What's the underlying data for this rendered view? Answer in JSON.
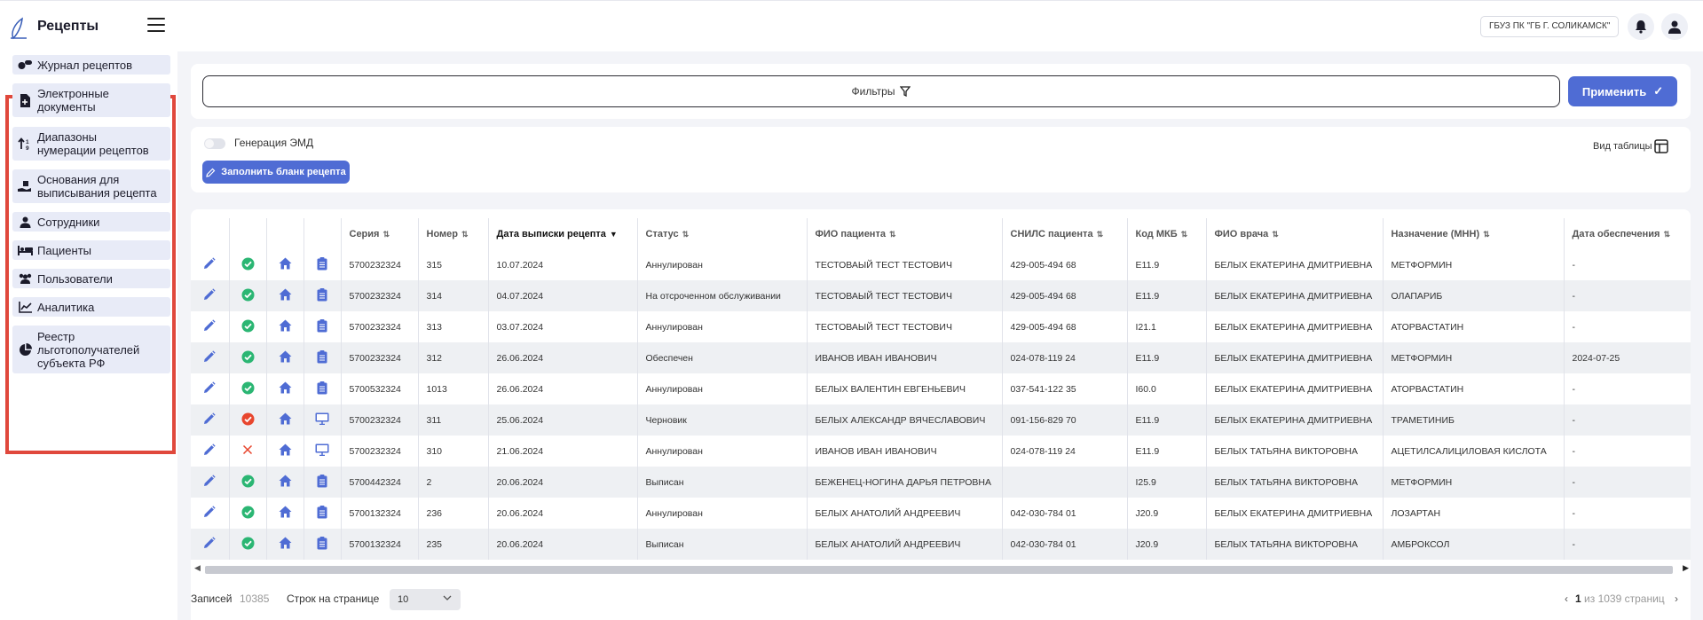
{
  "app": {
    "title": "Рецепты"
  },
  "header": {
    "org": "ГБУЗ ПК \"ГБ Г. СОЛИКАМСК\""
  },
  "sidebar": {
    "items": [
      {
        "label": "Журнал рецептов",
        "icon": "pills-icon"
      },
      {
        "label": "Электронные\nдокументы",
        "icon": "file-icon"
      },
      {
        "label": "Диапазоны\nнумерации рецептов",
        "icon": "sort-numeric-icon"
      },
      {
        "label": "Основания для\nвыписывания рецепта",
        "icon": "hand-receive-icon"
      },
      {
        "label": "Сотрудники",
        "icon": "user-icon"
      },
      {
        "label": "Пациенты",
        "icon": "bed-icon"
      },
      {
        "label": "Пользователи",
        "icon": "users-icon"
      },
      {
        "label": "Аналитика",
        "icon": "line-chart-icon"
      },
      {
        "label": "Реестр\nльготополучателей\nсубъекта РФ",
        "icon": "pie-chart-icon"
      }
    ]
  },
  "filters": {
    "label": "Фильтры",
    "apply_label": "Применить"
  },
  "toolbar": {
    "emd_toggle_label": "Генерация ЭМД",
    "fill_button_label": "Заполнить бланк рецепта",
    "view_label": "Вид таблицы"
  },
  "table": {
    "columns": [
      "Серия",
      "Номер",
      "Дата выписки рецепта",
      "Статус",
      "ФИО пациента",
      "СНИЛС пациента",
      "Код МКБ",
      "ФИО врача",
      "Назначение (МНН)",
      "Дата обеспечения"
    ],
    "rows": [
      {
        "status_icon": "check-circle-icon",
        "doc_icon": "clipboard-icon",
        "cells": [
          "5700232324",
          "315",
          "10.07.2024",
          "Аннулирован",
          "ТЕСТОВАЫЙ ТЕСТ ТЕСТОВИЧ",
          "429-005-494 68",
          "E11.9",
          "БЕЛЫХ ЕКАТЕРИНА ДМИТРИЕВНА",
          "МЕТФОРМИН",
          "-"
        ]
      },
      {
        "status_icon": "check-circle-icon",
        "doc_icon": "clipboard-icon",
        "cells": [
          "5700232324",
          "314",
          "04.07.2024",
          "На отсроченном обслуживании",
          "ТЕСТОВАЫЙ ТЕСТ ТЕСТОВИЧ",
          "429-005-494 68",
          "E11.9",
          "БЕЛЫХ ЕКАТЕРИНА ДМИТРИЕВНА",
          "ОЛАПАРИБ",
          "-"
        ]
      },
      {
        "status_icon": "check-circle-icon",
        "doc_icon": "clipboard-icon",
        "cells": [
          "5700232324",
          "313",
          "03.07.2024",
          "Аннулирован",
          "ТЕСТОВАЫЙ ТЕСТ ТЕСТОВИЧ",
          "429-005-494 68",
          "I21.1",
          "БЕЛЫХ ЕКАТЕРИНА ДМИТРИЕВНА",
          "АТОРВАСТАТИН",
          "-"
        ]
      },
      {
        "status_icon": "check-circle-icon",
        "doc_icon": "clipboard-icon",
        "cells": [
          "5700232324",
          "312",
          "26.06.2024",
          "Обеспечен",
          "ИВАНОВ ИВАН ИВАНОВИЧ",
          "024-078-119 24",
          "E11.9",
          "БЕЛЫХ ЕКАТЕРИНА ДМИТРИЕВНА",
          "МЕТФОРМИН",
          "2024-07-25"
        ]
      },
      {
        "status_icon": "check-circle-icon",
        "doc_icon": "clipboard-icon",
        "cells": [
          "5700532324",
          "1013",
          "26.06.2024",
          "Аннулирован",
          "БЕЛЫХ ВАЛЕНТИН ЕВГЕНЬЕВИЧ",
          "037-541-122 35",
          "I60.0",
          "БЕЛЫХ ЕКАТЕРИНА ДМИТРИЕВНА",
          "АТОРВАСТАТИН",
          "-"
        ]
      },
      {
        "status_icon": "error-circle-icon",
        "doc_icon": "monitor-icon",
        "cells": [
          "5700232324",
          "311",
          "25.06.2024",
          "Черновик",
          "БЕЛЫХ АЛЕКСАНДР ВЯЧЕСЛАВОВИЧ",
          "091-156-829 70",
          "E11.9",
          "БЕЛЫХ ЕКАТЕРИНА ДМИТРИЕВНА",
          "ТРАМЕТИНИБ",
          "-"
        ]
      },
      {
        "status_icon": "cross-icon",
        "doc_icon": "monitor-icon",
        "cells": [
          "5700232324",
          "310",
          "21.06.2024",
          "Аннулирован",
          "ИВАНОВ ИВАН ИВАНОВИЧ",
          "024-078-119 24",
          "E11.9",
          "БЕЛЫХ ТАТЬЯНА ВИКТОРОВНА",
          "АЦЕТИЛСАЛИЦИЛОВАЯ КИСЛОТА",
          "-"
        ]
      },
      {
        "status_icon": "check-circle-icon",
        "doc_icon": "clipboard-icon",
        "cells": [
          "5700442324",
          "2",
          "20.06.2024",
          "Выписан",
          "БЕЖЕНЕЦ-НОГИНА ДАРЬЯ ПЕТРОВНА",
          "",
          "I25.9",
          "БЕЛЫХ ТАТЬЯНА ВИКТОРОВНА",
          "МЕТФОРМИН",
          "-"
        ]
      },
      {
        "status_icon": "check-circle-icon",
        "doc_icon": "clipboard-icon",
        "cells": [
          "5700132324",
          "236",
          "20.06.2024",
          "Аннулирован",
          "БЕЛЫХ АНАТОЛИЙ АНДРЕЕВИЧ",
          "042-030-784 01",
          "J20.9",
          "БЕЛЫХ ЕКАТЕРИНА ДМИТРИЕВНА",
          "ЛОЗАРТАН",
          "-"
        ]
      },
      {
        "status_icon": "check-circle-icon",
        "doc_icon": "clipboard-icon",
        "cells": [
          "5700132324",
          "235",
          "20.06.2024",
          "Выписан",
          "БЕЛЫХ АНАТОЛИЙ АНДРЕЕВИЧ",
          "042-030-784 01",
          "J20.9",
          "БЕЛЫХ ТАТЬЯНА ВИКТОРОВНА",
          "АМБРОКСОЛ",
          "-"
        ]
      }
    ]
  },
  "footer": {
    "total_label": "Записей",
    "total": "10385",
    "rows_label": "Строк на странице",
    "rows_per_page": "10",
    "page_current": "1",
    "page_rest": "из 1039 страниц"
  },
  "colors": {
    "accent": "#4f6cd4",
    "success": "#2bb673",
    "error": "#e8462e",
    "highlight_frame": "#e0483c"
  }
}
